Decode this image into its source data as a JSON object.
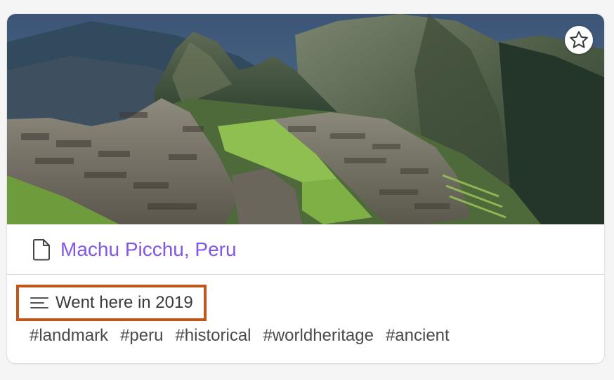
{
  "card": {
    "cover_image": "machu-picchu-photo",
    "favorite_icon": "star-outline-icon",
    "page_icon": "document-icon",
    "title": "Machu Picchu, Peru",
    "title_color": "#8257e6",
    "description_icon": "text-lines-icon",
    "description": "Went here in 2019",
    "highlight_color": "#c0561a",
    "tags": [
      "#landmark",
      "#peru",
      "#historical",
      "#worldheritage",
      "#ancient"
    ]
  }
}
